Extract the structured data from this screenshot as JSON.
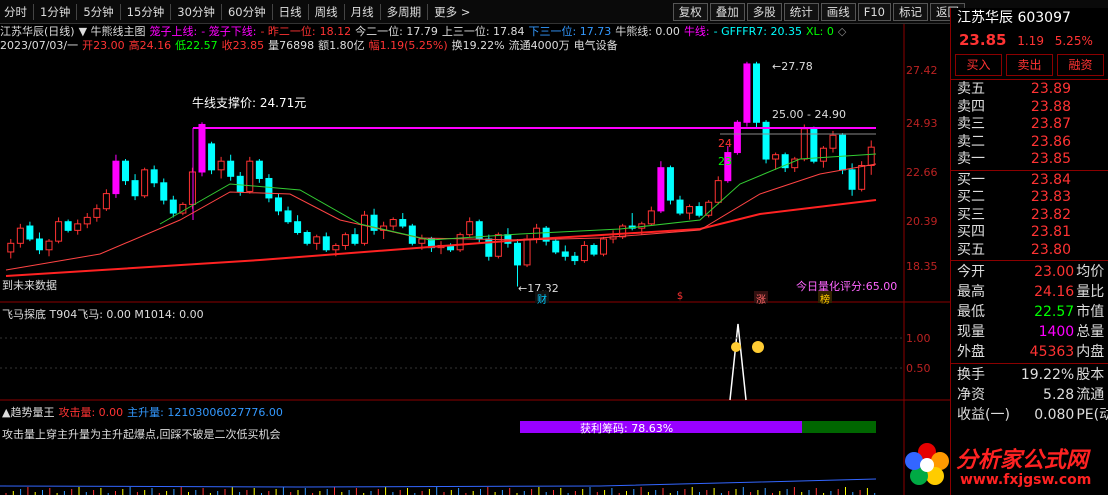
{
  "toolbar": {
    "left_items": [
      "分时",
      "1分钟",
      "5分钟",
      "15分钟",
      "30分钟",
      "60分钟",
      "日线",
      "周线",
      "月线",
      "多周期",
      "更多 >"
    ],
    "right_items": [
      "复权",
      "叠加",
      "多股",
      "统计",
      "画线",
      "F10",
      "标记",
      "返回"
    ]
  },
  "main": {
    "title_line": [
      {
        "text": "江苏华辰(日线)",
        "color": "#dddddd"
      },
      {
        "text": "▼ 牛熊线主图",
        "color": "#dddddd"
      },
      {
        "text": "笼子上线:",
        "color": "#ff00ff"
      },
      {
        "text": "- 笼子下线:",
        "color": "#ff00ff"
      },
      {
        "text": "- 昨二一位:",
        "color": "#ff3333"
      },
      {
        "text": "18.12",
        "color": "#ff3333"
      },
      {
        "text": "今二一位: 17.79",
        "color": "#dddddd"
      },
      {
        "text": "上三一位: 17.84",
        "color": "#dddddd"
      },
      {
        "text": "下三一位: 17.73",
        "color": "#3399ff"
      },
      {
        "text": "牛熊线: 0.00",
        "color": "#dddddd"
      },
      {
        "text": "牛线:",
        "color": "#ff00ff"
      },
      {
        "text": "- GFFFR7: 20.35",
        "color": "#00ffff"
      },
      {
        "text": "XL: 0",
        "color": "#00ff00"
      },
      {
        "text": "◇",
        "color": "#888888"
      }
    ],
    "info_line": [
      {
        "text": "2023/07/03/一",
        "color": "#dddddd"
      },
      {
        "text": "开23.00",
        "color": "#ff3333"
      },
      {
        "text": "高24.16",
        "color": "#ff3333"
      },
      {
        "text": "低22.57",
        "color": "#00ff00"
      },
      {
        "text": "收23.85",
        "color": "#ff3333"
      },
      {
        "text": "量76898",
        "color": "#dddddd"
      },
      {
        "text": "额1.80亿",
        "color": "#dddddd"
      },
      {
        "text": "幅1.19(5.25%)",
        "color": "#ff3333"
      },
      {
        "text": "换19.22%",
        "color": "#dddddd"
      },
      {
        "text": "流通4000万",
        "color": "#dddddd"
      },
      {
        "text": "电气设备",
        "color": "#dddddd"
      }
    ],
    "y_axis": [
      "27.42",
      "24.93",
      "22.66",
      "20.39",
      "18.35"
    ],
    "support_label": "牛线支撑价: 24.71元",
    "high_label": "27.78",
    "low_label": "17.32",
    "range_label": "25.00 - 24.90",
    "small_24": "24",
    "small_23": "23",
    "future_label": "到未来数据",
    "score_label": "今日量化评分:65.00",
    "markers": [
      {
        "text": "财",
        "color": "#00ccff"
      },
      {
        "text": "$",
        "color": "#ff3333"
      },
      {
        "text": "涨",
        "color": "#ff6666"
      },
      {
        "text": "榜",
        "color": "#ffcc00"
      }
    ]
  },
  "sub1": {
    "title": "飞马探底  T904飞马: 0.00  M1014: 0.00",
    "y_axis": [
      "1.00",
      "0.50"
    ]
  },
  "sub2": {
    "title_parts": [
      {
        "text": "▲趋势量王",
        "color": "#dddddd"
      },
      {
        "text": "攻击量: 0.00",
        "color": "#ff3333"
      },
      {
        "text": "主升量: 12103006027776.00",
        "color": "#3399ff"
      }
    ],
    "desc": "攻击量上穿主升量为主升起爆点,回踩不破是二次低买机会",
    "bar_label": "获利筹码: 78.63%"
  },
  "quote": {
    "name": "江苏华辰",
    "code": "603097",
    "price": "23.85",
    "change": "1.19",
    "change_pct": "5.25%",
    "buttons": [
      "买入",
      "卖出",
      "融资"
    ],
    "asks": [
      {
        "label": "卖五",
        "price": "23.89"
      },
      {
        "label": "卖四",
        "price": "23.88"
      },
      {
        "label": "卖三",
        "price": "23.87"
      },
      {
        "label": "卖二",
        "price": "23.86"
      },
      {
        "label": "卖一",
        "price": "23.85"
      }
    ],
    "bids": [
      {
        "label": "买一",
        "price": "23.84"
      },
      {
        "label": "买二",
        "price": "23.83"
      },
      {
        "label": "买三",
        "price": "23.82"
      },
      {
        "label": "买四",
        "price": "23.81"
      },
      {
        "label": "买五",
        "price": "23.80"
      }
    ],
    "stats": [
      {
        "label": "今开",
        "value": "23.00",
        "color": "#ff3333",
        "label2": "均价"
      },
      {
        "label": "最高",
        "value": "24.16",
        "color": "#ff3333",
        "label2": "量比"
      },
      {
        "label": "最低",
        "value": "22.57",
        "color": "#00ff00",
        "label2": "市值"
      },
      {
        "label": "现量",
        "value": "1400",
        "color": "#ff00ff",
        "label2": "总量"
      },
      {
        "label": "外盘",
        "value": "45363",
        "color": "#ff3333",
        "label2": "内盘"
      }
    ],
    "stats2": [
      {
        "label": "换手",
        "value": "19.22%",
        "color": "#dddddd",
        "label2": "股本"
      },
      {
        "label": "净资",
        "value": "5.28",
        "color": "#dddddd",
        "label2": "流通"
      },
      {
        "label": "收益(一)",
        "value": "0.080",
        "color": "#dddddd",
        "label2": "PE(动"
      }
    ]
  },
  "logo": {
    "text": "分析家公式网",
    "url": "www.fxjgsw.com"
  },
  "colors": {
    "up": "#ff3333",
    "down": "#00ffff",
    "magenta": "#ff00ff",
    "frame": "#8b0000"
  }
}
